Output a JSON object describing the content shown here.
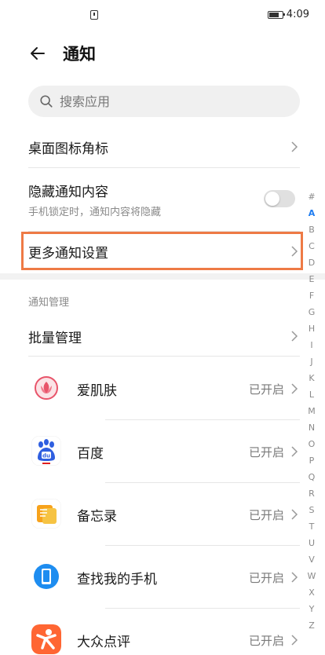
{
  "status_bar": {
    "time": "4:09"
  },
  "header": {
    "title": "通知"
  },
  "search": {
    "placeholder": "搜索应用"
  },
  "settings": {
    "desktop_badge": "桌面图标角标",
    "hide_content": "隐藏通知内容",
    "hide_content_desc": "手机锁定时，通知内容将隐藏",
    "hide_content_enabled": false,
    "more_settings": "更多通知设置"
  },
  "section": {
    "title": "通知管理"
  },
  "batch": {
    "label": "批量管理"
  },
  "apps": [
    {
      "name": "爱肌肤",
      "status": "已开启",
      "icon": "aijifu-app-icon"
    },
    {
      "name": "百度",
      "status": "已开启",
      "icon": "baidu-app-icon"
    },
    {
      "name": "备忘录",
      "status": "已开启",
      "icon": "notes-app-icon"
    },
    {
      "name": "查找我的手机",
      "status": "已开启",
      "icon": "find-phone-app-icon"
    },
    {
      "name": "大众点评",
      "status": "已开启",
      "icon": "dianping-app-icon"
    }
  ],
  "alphabet": [
    "#",
    "A",
    "B",
    "C",
    "D",
    "E",
    "F",
    "G",
    "H",
    "I",
    "J",
    "K",
    "L",
    "M",
    "N",
    "O",
    "P",
    "Q",
    "R",
    "S",
    "T",
    "U",
    "V",
    "W",
    "X",
    "Y",
    "Z"
  ],
  "alphabet_active": "A",
  "colors": {
    "highlight": "#ee7a45",
    "accent": "#1e7cf0"
  }
}
